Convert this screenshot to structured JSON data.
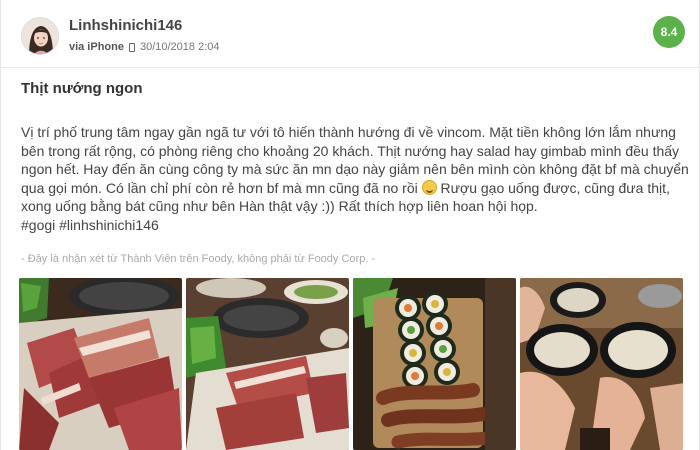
{
  "review": {
    "username": "Linhshinichi146",
    "via_label": "via",
    "device": "iPhone",
    "datetime": "30/10/2018 2:04",
    "score": "8.4",
    "title": "Thịt nướng ngon",
    "body_lines": [
      "Vị trí phố trung tâm ngay gần ngã tư với tô hiến thành hướng đi về vincom. Mặt tiền không lớn lắm nhưng",
      "bên trong rất rộng, có phòng riêng cho khoảng 20 khách. Thịt nướng hay salad hay gimbab mình đều thấy",
      "ngon hết. Hay đến ăn cùng công ty mà sức ăn mn dạo này giảm nên bên mình còn không đặt bf mà chuyển",
      "qua gọi món. Có lần chỉ phí còn rẻ hơn bf mà mn cũng đã no rồi",
      "Rượu gạo uống được, cũng đưa thịt,",
      "xong uống bằng bát cũng như bên Hàn thật vậy :)) Rất thích hợp liên hoan hội họp.",
      "#gogi #linhshinichi146"
    ],
    "disclaimer": "- Đây là nhận xét từ Thành Viên trên Foody, không phải từ Foody Corp. -"
  },
  "photos": [
    {
      "name": "photo-raw-meat-platter"
    },
    {
      "name": "photo-grill-table"
    },
    {
      "name": "photo-kimbap-sausage"
    },
    {
      "name": "photo-rice-wine-bowls"
    }
  ],
  "colors": {
    "score_badge": "#5bb24a",
    "text": "#444444",
    "disclaimer": "#aaaaaa"
  }
}
